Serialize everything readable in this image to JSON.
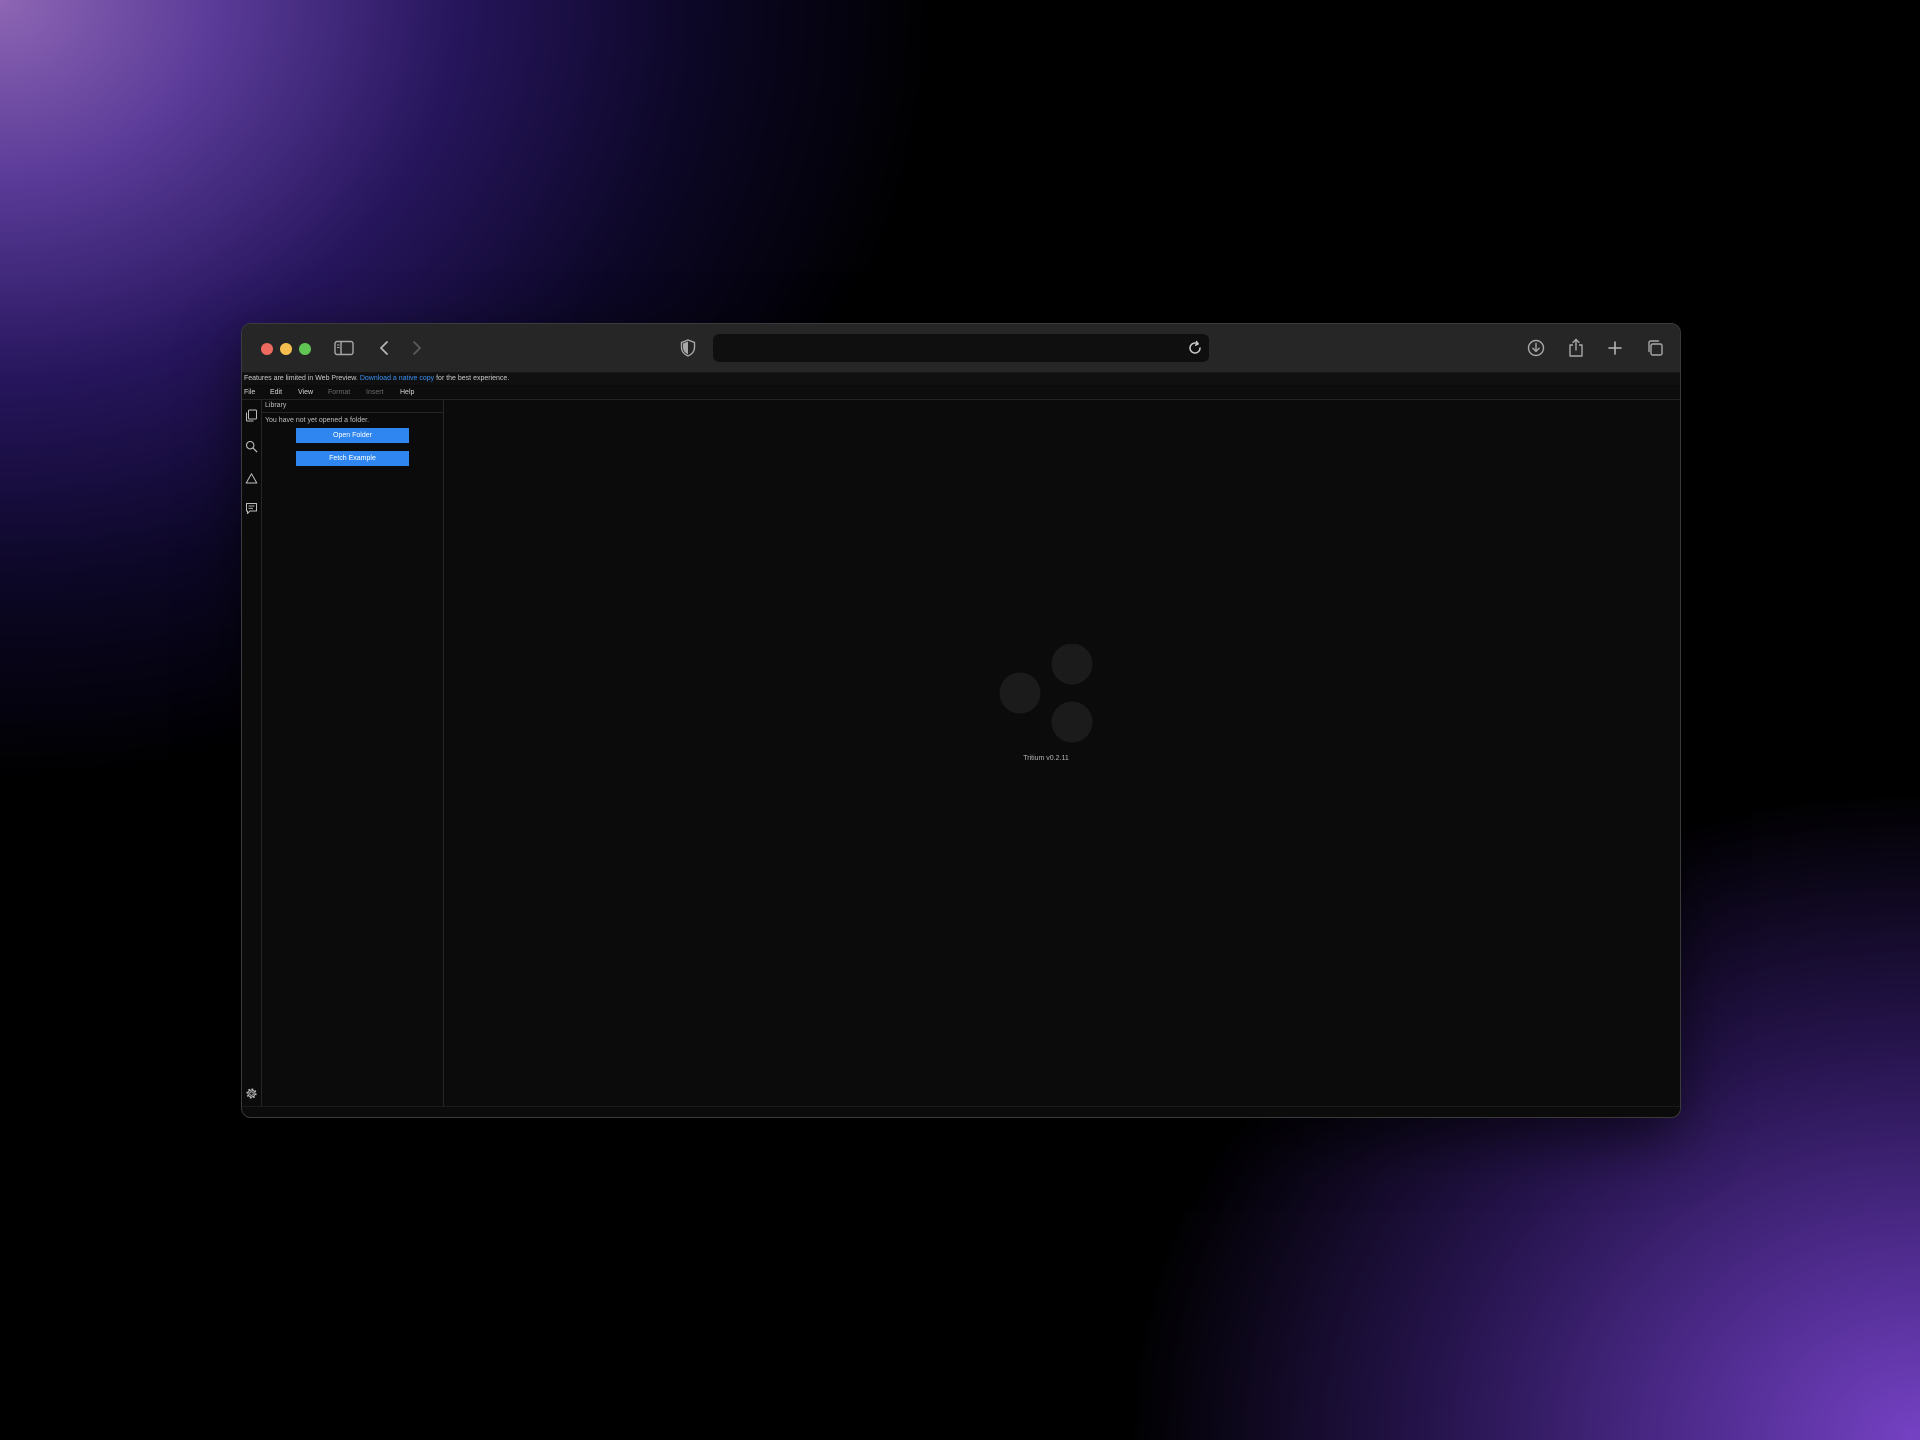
{
  "browser": {
    "address_value": "",
    "icons": {
      "sidebar_toggle": "sidebar-toggle-icon",
      "back": "chevron-left-icon",
      "forward": "chevron-right-icon",
      "privacy": "shield-icon",
      "reload": "reload-icon",
      "downloads": "download-icon",
      "share": "share-icon",
      "new_tab": "plus-icon",
      "tabs": "tab-overview-icon"
    }
  },
  "banner": {
    "prefix": "Features are limited in Web Preview.",
    "link": "Download a native copy",
    "suffix": "for the best experience."
  },
  "menu": {
    "file": "File",
    "edit": "Edit",
    "view": "View",
    "format": "Format",
    "insert": "Insert",
    "help": "Help"
  },
  "sidebar": {
    "title": "Library",
    "message": "You have not yet opened a folder.",
    "open_folder": "Open Folder",
    "fetch_example": "Fetch Example"
  },
  "main": {
    "version": "Tritium v0.2.11"
  },
  "colors": {
    "accent": "#2f86f0",
    "link": "#3a8ef2",
    "traffic_red": "#ed6a5e",
    "traffic_yellow": "#f4bf4f",
    "traffic_green": "#61c554"
  }
}
